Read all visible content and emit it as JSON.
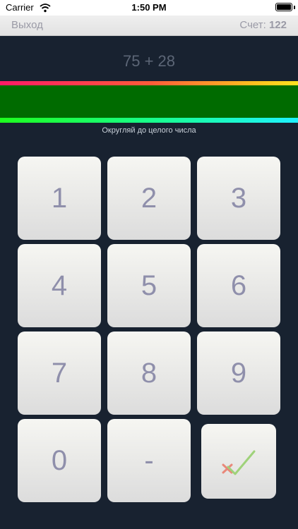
{
  "status_bar": {
    "carrier": "Carrier",
    "time": "1:50 PM"
  },
  "nav": {
    "exit_label": "Выход",
    "score_label": "Счет:",
    "score_value": "122"
  },
  "problem": "75 + 28",
  "hint": "Округляй до целого числа",
  "keypad": {
    "k1": "1",
    "k2": "2",
    "k3": "3",
    "k4": "4",
    "k5": "5",
    "k6": "6",
    "k7": "7",
    "k8": "8",
    "k9": "9",
    "k0": "0",
    "minus": "-"
  },
  "colors": {
    "background": "#182230",
    "bar_fill": "#006b00",
    "key_text": "#8f8fab",
    "submit_check": "#9fd27a",
    "submit_cross": "#e9887a"
  },
  "icons": {
    "submit": "check-cross-icon",
    "wifi": "wifi-icon",
    "battery": "battery-icon"
  }
}
